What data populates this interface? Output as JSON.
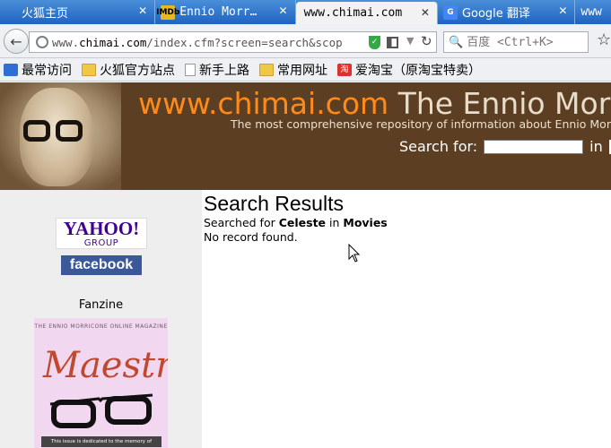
{
  "tabs": [
    {
      "label": "火狐主页",
      "icon": "firefox-icon",
      "active": false
    },
    {
      "label": "Ennio Morr…",
      "icon": "imdb-icon",
      "active": false
    },
    {
      "label": "www.chimai.com",
      "icon": "none",
      "active": true
    },
    {
      "label": "Google 翻译",
      "icon": "google-translate-icon",
      "active": false
    },
    {
      "label": "www",
      "icon": "none",
      "active": false
    }
  ],
  "navbar": {
    "url_prefix": "www.",
    "url_domain": "chimai.com",
    "url_path": "/index.cfm?screen=search&scop",
    "search_placeholder": "百度 <Ctrl+K>"
  },
  "bookmarks": [
    {
      "label": "最常访问",
      "icon": "rss-icon"
    },
    {
      "label": "火狐官方站点",
      "icon": "folder-icon"
    },
    {
      "label": "新手上路",
      "icon": "page-icon"
    },
    {
      "label": "常用网址",
      "icon": "folder-icon"
    },
    {
      "label": "爱淘宝（原淘宝特卖）",
      "icon": "taobao-icon"
    }
  ],
  "site": {
    "title_domain": "www.chimai.com",
    "title_rest": " The Ennio Morr",
    "tagline": "The most comprehensive repository of information about Ennio Mor",
    "search_label": "Search for:",
    "search_in": "in"
  },
  "sidebar": {
    "yahoo_logo": "YAHOO!",
    "yahoo_sub": "GROUP",
    "facebook_logo": "facebook",
    "fanzine_label": "Fanzine",
    "magazine_header": "THE ENNIO MORRICONE ONLINE MAGAZINE",
    "magazine_title": "Maestro",
    "magazine_footer": "This issue is dedicated to the memory of"
  },
  "main": {
    "title": "Search Results",
    "searched_prefix": "Searched for ",
    "searched_term": "Celeste",
    "searched_in": " in ",
    "searched_category": "Movies",
    "no_record": "No record found."
  },
  "colors": {
    "tab_strip": "#1f63c2",
    "site_header": "#5c3f22",
    "title_orange": "#ff8a1a",
    "facebook_blue": "#3b5998",
    "yahoo_purple": "#410093"
  }
}
